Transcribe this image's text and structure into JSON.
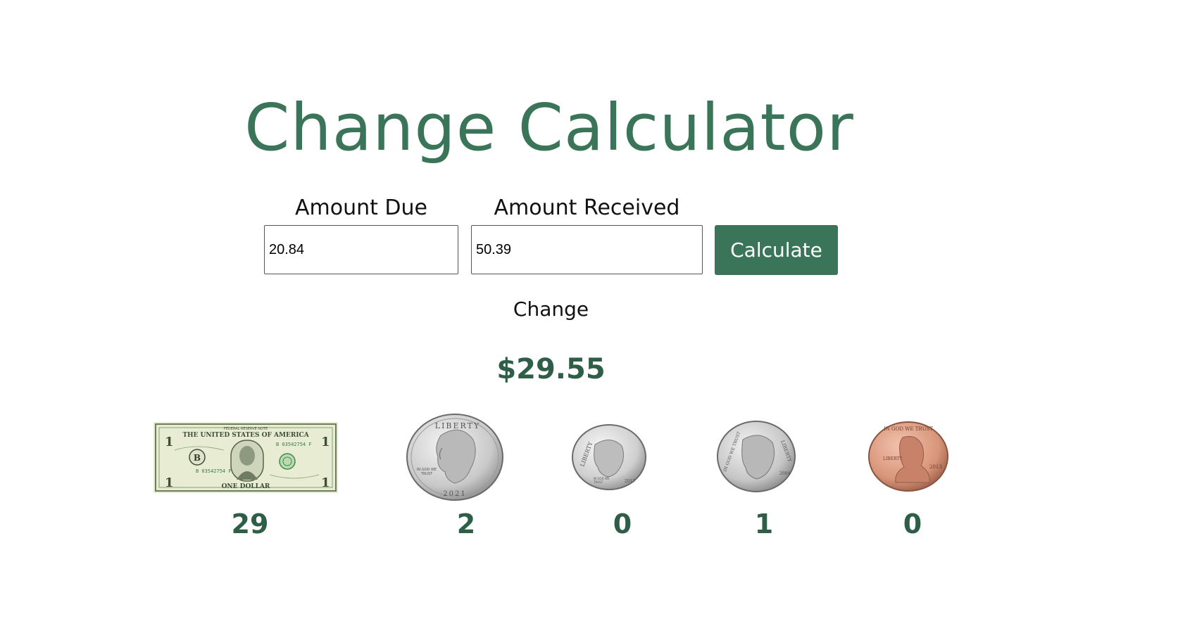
{
  "title": "Change Calculator",
  "form": {
    "amount_due_label": "Amount Due",
    "amount_due_value": "20.84",
    "amount_received_label": "Amount Received",
    "amount_received_value": "50.39",
    "calculate_label": "Calculate"
  },
  "result": {
    "change_label": "Change",
    "change_amount": "$29.55"
  },
  "denominations": {
    "dollars": {
      "count": "29",
      "image": "one-dollar-bill"
    },
    "quarters": {
      "count": "2",
      "image": "quarter-coin"
    },
    "dimes": {
      "count": "0",
      "image": "dime-coin"
    },
    "nickels": {
      "count": "1",
      "image": "nickel-coin"
    },
    "pennies": {
      "count": "0",
      "image": "penny-coin"
    }
  },
  "bill_text": {
    "top_banner": "THE UNITED STATES OF AMERICA",
    "bottom_banner": "ONE DOLLAR",
    "serial": "B 03542754 F",
    "corner": "1",
    "seal_letter": "B"
  },
  "coin_text": {
    "quarter_top": "LIBERTY",
    "quarter_motto": "IN GOD WE TRUST",
    "quarter_year": "2021",
    "dime_top": "LIBERTY",
    "dime_motto": "IN GOD WE TRUST",
    "dime_year": "2017",
    "nickel_left": "IN GOD WE TRUST",
    "nickel_right": "LIBERTY",
    "nickel_year": "2004",
    "penny_top": "IN GOD WE TRUST",
    "penny_left": "LIBERTY",
    "penny_year": "2013"
  },
  "colors": {
    "accent": "#3a7559",
    "accent_dark": "#2f5e48",
    "bill_green": "#5e7a52",
    "silver": "#c9c9c9",
    "copper": "#d7957a"
  }
}
